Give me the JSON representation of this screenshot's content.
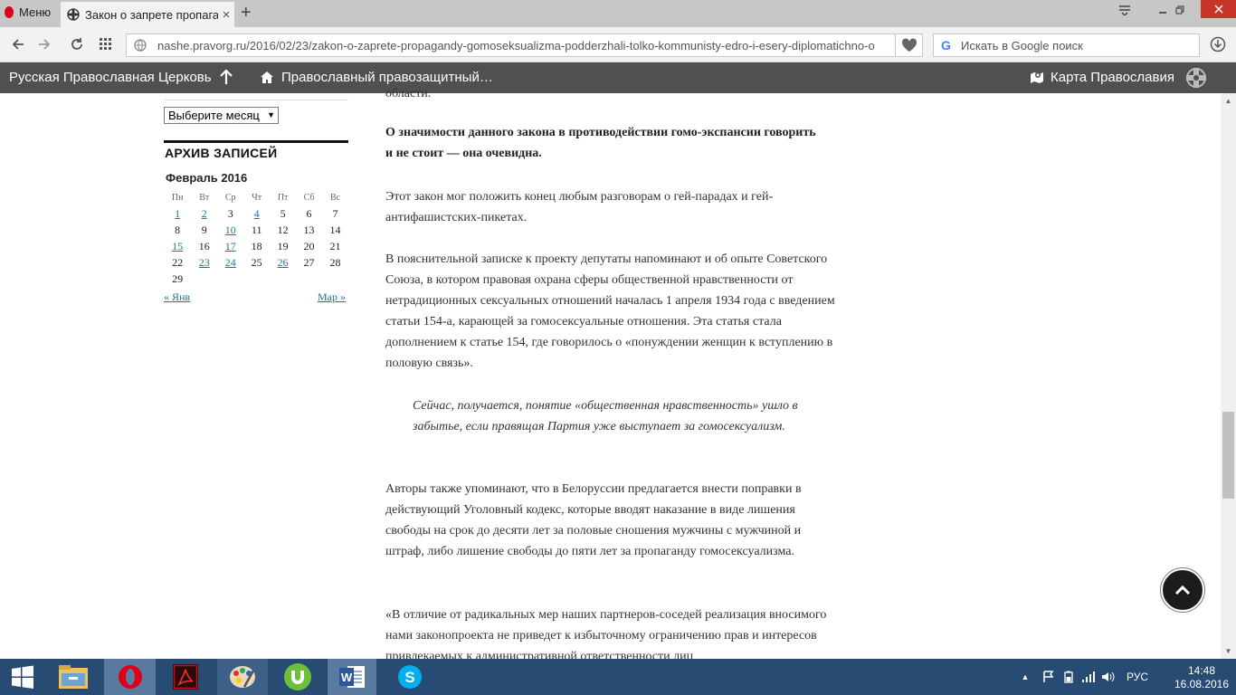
{
  "browser": {
    "menu_label": "Меню",
    "tab_title": "Закон о запрете пропага",
    "url": "nashe.pravorg.ru/2016/02/23/zakon-o-zaprete-propagandy-gomoseksualizma-podderzhali-tolko-kommunisty-edro-i-esery-diplomatichno-o",
    "search_placeholder": "Искать в Google поиск"
  },
  "site_header": {
    "title": "Русская Православная Церковь",
    "home_link": "Православный правозащитный…",
    "map_link": "Карта Православия"
  },
  "sidebar": {
    "month_select_value": "Выберите месяц",
    "archive_title": "АРХИВ ЗАПИСЕЙ",
    "calendar_caption": "Февраль 2016",
    "weekdays": [
      "Пн",
      "Вт",
      "Ср",
      "Чт",
      "Пт",
      "Сб",
      "Вс"
    ],
    "weeks": [
      [
        {
          "d": "1",
          "link": true
        },
        {
          "d": "2",
          "link": true
        },
        {
          "d": "3"
        },
        {
          "d": "4",
          "link": true
        },
        {
          "d": "5"
        },
        {
          "d": "6"
        },
        {
          "d": "7"
        }
      ],
      [
        {
          "d": "8"
        },
        {
          "d": "9"
        },
        {
          "d": "10",
          "link": true
        },
        {
          "d": "11"
        },
        {
          "d": "12"
        },
        {
          "d": "13"
        },
        {
          "d": "14"
        }
      ],
      [
        {
          "d": "15",
          "link": true
        },
        {
          "d": "16"
        },
        {
          "d": "17",
          "link": true
        },
        {
          "d": "18"
        },
        {
          "d": "19"
        },
        {
          "d": "20"
        },
        {
          "d": "21"
        }
      ],
      [
        {
          "d": "22"
        },
        {
          "d": "23",
          "link": true
        },
        {
          "d": "24",
          "link": true
        },
        {
          "d": "25"
        },
        {
          "d": "26",
          "link": true
        },
        {
          "d": "27"
        },
        {
          "d": "28"
        }
      ],
      [
        {
          "d": "29"
        },
        {
          "d": ""
        },
        {
          "d": ""
        },
        {
          "d": ""
        },
        {
          "d": ""
        },
        {
          "d": ""
        },
        {
          "d": ""
        }
      ]
    ],
    "prev_link": "« Янв",
    "next_link": "Мар »"
  },
  "article": {
    "cut_line": "области.",
    "bold_paragraph": "О значимости данного закона в противодействии гомо-экспансии говорить и не стоит — она очевидна.",
    "p1": "Этот закон мог положить конец любым разговорам о гей-парадах и гей-антифашистских-пикетах.",
    "p2": "В пояснительной записке к проекту депутаты напоминают и об опыте Советского Союза, в котором правовая охрана сферы общественной нравственности от нетрадиционных сексуальных отношений началась 1 апреля 1934 года с введением статьи 154-а, карающей за гомосексуальные отношения. Эта статья стала дополнением к статье 154, где говорилось о «понуждении женщин к вступлению в половую связь».",
    "quote": "Сейчас, получается, понятие «общественная нравственность» ушло в забытье, если правящая Партия уже выступает за гомосексуализм.",
    "p3": "Авторы также упоминают, что в Белоруссии предлагается внести поправки в действующий Уголовный кодекс, которые вводят наказание в виде лишения свободы на срок до десяти лет за половые сношения мужчины с мужчиной и штраф, либо лишение свободы до пяти лет за пропаганду гомосексуализма.",
    "p4": "«В отличие от радикальных мер наших партнеров-соседей реализация вносимого нами законопроекта не приведет к избыточному ограничению прав и интересов привлекаемых к административной ответственности лиц"
  },
  "taskbar": {
    "apps": [
      "start-button",
      "file-explorer-icon",
      "opera-icon",
      "acrobat-icon",
      "paint-icon",
      "utorrent-icon",
      "word-icon",
      "skype-icon"
    ],
    "language": "РУС",
    "time": "14:48",
    "date": "16.08.2016"
  },
  "colors": {
    "site_header_bg": "#505050",
    "link": "#21759b",
    "taskbar_bg": "#284b73"
  }
}
